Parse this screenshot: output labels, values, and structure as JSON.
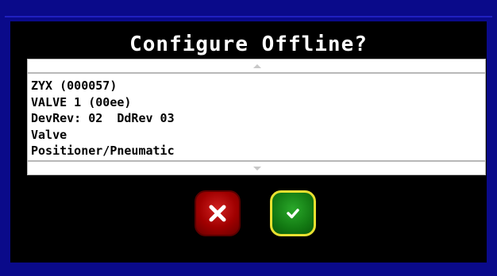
{
  "dialog": {
    "title": "Configure Offline?",
    "info_lines": [
      "ZYX (000057)",
      "VALVE 1 (00ee)",
      "DevRev: 02  DdRev 03",
      "Valve",
      "Positioner/Pneumatic"
    ],
    "scroll_up_icon": "triangle-up",
    "scroll_down_icon": "triangle-down"
  },
  "buttons": {
    "cancel_icon": "x-icon",
    "confirm_icon": "checkmark-icon"
  },
  "colors": {
    "frame_blue": "#0a0a8a",
    "dialog_bg": "#000000",
    "cancel_red": "#a00000",
    "confirm_green": "#137a13",
    "confirm_border_yellow": "#e8e030"
  }
}
